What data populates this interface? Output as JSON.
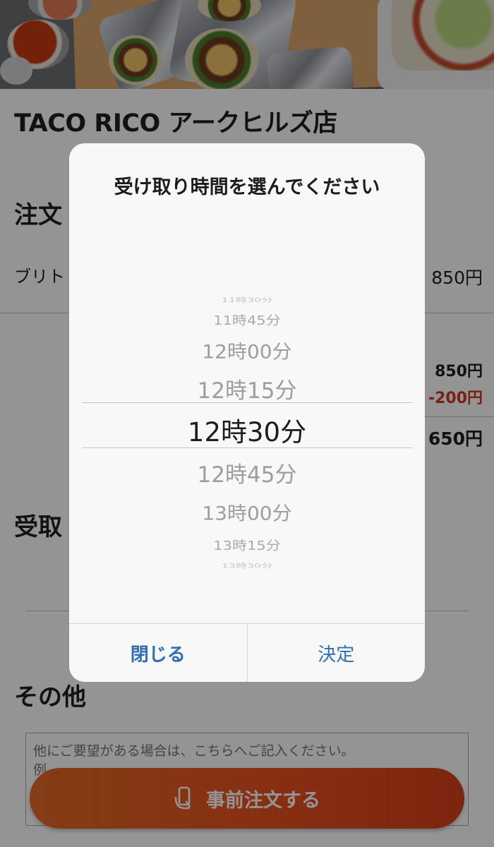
{
  "store": {
    "name": "TACO RICO アークヒルズ店"
  },
  "sections": {
    "order_title": "注文",
    "pickup_title": "受取",
    "other_title": "その他"
  },
  "order": {
    "item_name": "ブリト",
    "item_price": "850円",
    "subtotal": "850円",
    "discount": "-200円",
    "total": "650円"
  },
  "notes": {
    "placeholder": "他にご要望がある場合は、こちらへご記入ください。\n例"
  },
  "order_button": {
    "label": "事前注文する",
    "icon": "phone-hand-icon"
  },
  "modal": {
    "title": "受け取り時間を選んでください",
    "options": [
      "11時30分",
      "11時45分",
      "12時00分",
      "12時15分",
      "12時30分",
      "12時45分",
      "13時00分",
      "13時15分",
      "13時30分"
    ],
    "selected": "12時30分",
    "close_label": "閉じる",
    "confirm_label": "決定"
  },
  "colors": {
    "accent_blue": "#2f6fb6",
    "order_button": "#e94f20",
    "discount_red": "#d2361e"
  }
}
